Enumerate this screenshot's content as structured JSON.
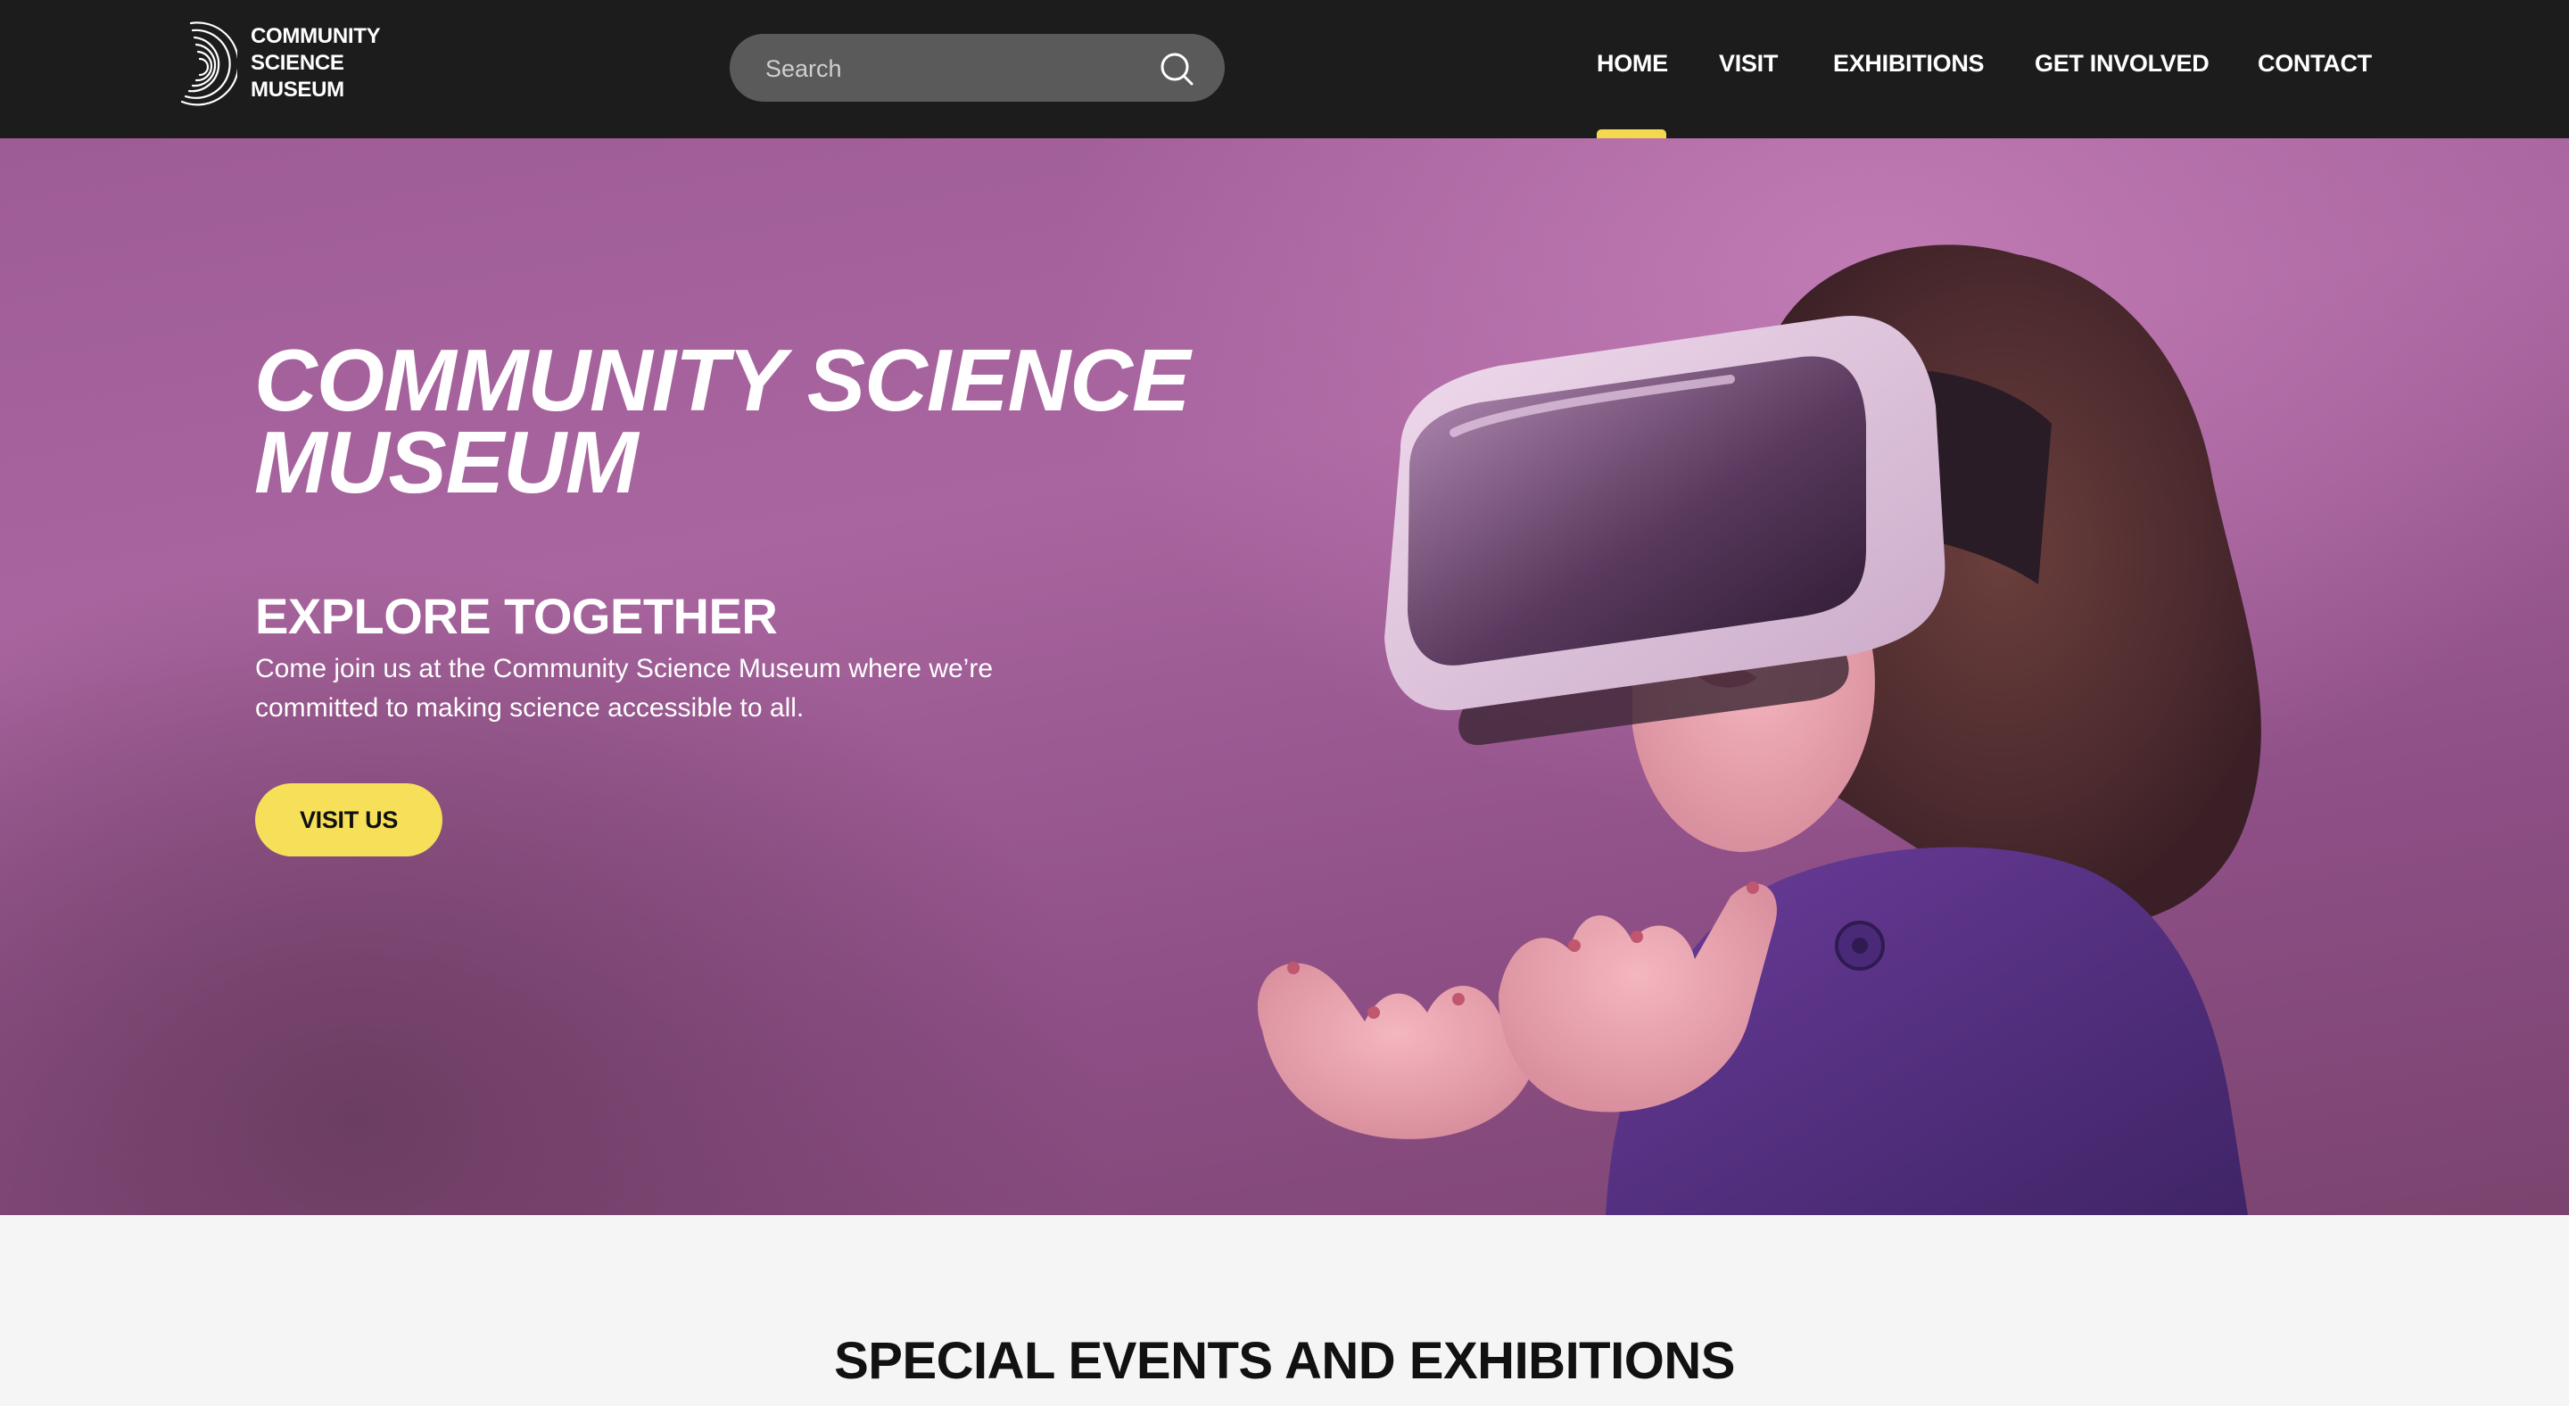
{
  "header": {
    "logo": {
      "lines": [
        "COMMUNITY",
        "SCIENCE",
        "MUSEUM"
      ]
    },
    "search": {
      "placeholder": "Search",
      "value": ""
    },
    "nav": [
      {
        "label": "HOME",
        "active": true
      },
      {
        "label": "VISIT",
        "active": false
      },
      {
        "label": "EXHIBITIONS",
        "active": false
      },
      {
        "label": "GET INVOLVED",
        "active": false
      },
      {
        "label": "CONTACT",
        "active": false
      }
    ],
    "accent_color": "#f4d94f",
    "background_color": "#1c1c1c"
  },
  "hero": {
    "title": "COMMUNITY SCIENCE MUSEUM",
    "subtitle": "EXPLORE TOGETHER",
    "description": "Come join us at the Community Science Museum where we’re committed to making science accessible to all.",
    "cta_label": "VISIT US",
    "cta_color": "#f6e05a",
    "background_color": "#a6639c",
    "image_icon": "child-vr-headset-photo"
  },
  "section": {
    "heading": "SPECIAL EVENTS AND EXHIBITIONS"
  }
}
